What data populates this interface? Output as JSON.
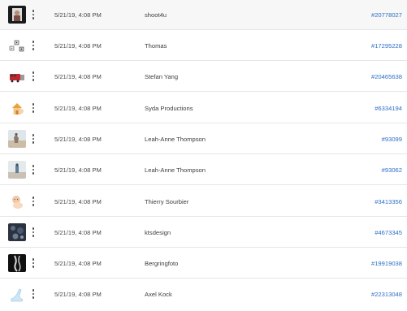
{
  "rows": [
    {
      "date": "5/21/19, 4:08 PM",
      "artist": "shoot4u",
      "asset_id": "#20778027",
      "thumb": "dark-portrait-thumbnail"
    },
    {
      "date": "5/21/19, 4:08 PM",
      "artist": "Thomas",
      "asset_id": "#17295228",
      "thumb": "dice-thumbnail"
    },
    {
      "date": "5/21/19, 4:08 PM",
      "artist": "Stefan Yang",
      "asset_id": "#20465638",
      "thumb": "red-bus-thumbnail"
    },
    {
      "date": "5/21/19, 4:08 PM",
      "artist": "Syda Productions",
      "asset_id": "#6334194",
      "thumb": "house-model-thumbnail"
    },
    {
      "date": "5/21/19, 4:08 PM",
      "artist": "Leah-Anne Thompson",
      "asset_id": "#93099",
      "thumb": "beach-thumbnail"
    },
    {
      "date": "5/21/19, 4:08 PM",
      "artist": "Leah-Anne Thompson",
      "asset_id": "#93062",
      "thumb": "beach-scene-thumbnail"
    },
    {
      "date": "5/21/19, 4:08 PM",
      "artist": "Thierry Sourbier",
      "asset_id": "#3413356",
      "thumb": "baby-thumbnail"
    },
    {
      "date": "5/21/19, 4:08 PM",
      "artist": "ktsdesign",
      "asset_id": "#4673345",
      "thumb": "dark-texture-thumbnail"
    },
    {
      "date": "5/21/19, 4:08 PM",
      "artist": "Bergringfoto",
      "asset_id": "#19919038",
      "thumb": "xray-thumbnail"
    },
    {
      "date": "5/21/19, 4:08 PM",
      "artist": "Axel Kock",
      "asset_id": "#22313048",
      "thumb": "glass-shoe-thumbnail"
    }
  ],
  "colors": {
    "link": "#2d6fc6",
    "text": "#3d3d3d",
    "divider": "#e6e6e6"
  }
}
